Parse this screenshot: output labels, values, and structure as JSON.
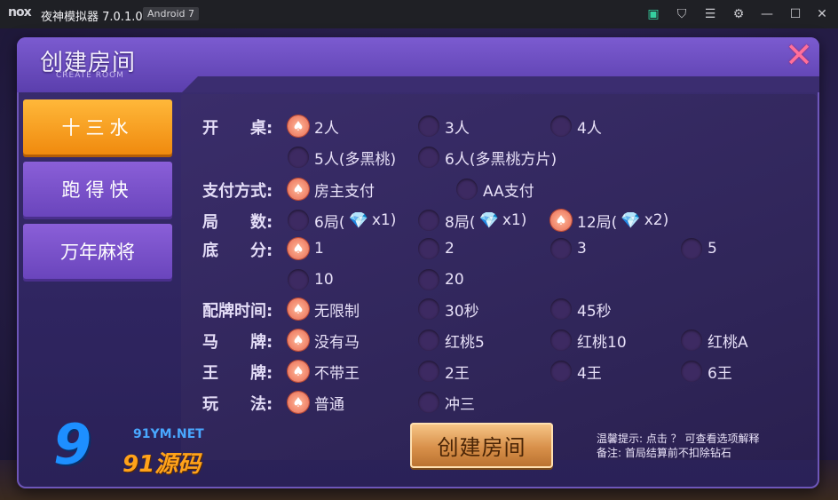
{
  "emulator": {
    "logo": "nox",
    "title": "夜神模拟器 7.0.1.0",
    "android": "Android 7",
    "icons": [
      "bag-icon",
      "shirt-icon",
      "menu-icon",
      "gear-icon",
      "minimize-icon",
      "maximize-icon",
      "close-icon"
    ]
  },
  "dialog": {
    "title": "创建房间",
    "subtitle": "CREATE ROOM",
    "close": "✕"
  },
  "tabs": [
    {
      "label": "十三水",
      "active": true
    },
    {
      "label": "跑得快",
      "active": false
    },
    {
      "label": "万年麻将",
      "active": false
    }
  ],
  "rows": {
    "tables": {
      "label": "开　　桌:",
      "options": [
        "2人",
        "3人",
        "4人",
        "5人(多黑桃)",
        "6人(多黑桃方片)"
      ],
      "selected": "2人"
    },
    "payment": {
      "label": "支付方式:",
      "options": [
        "房主支付",
        "AA支付"
      ],
      "selected": "房主支付"
    },
    "rounds": {
      "label": "局　　数:",
      "options": [
        {
          "text": "6局(",
          "mult": "x1)"
        },
        {
          "text": "8局(",
          "mult": "x1)"
        },
        {
          "text": "12局(",
          "mult": "x2)"
        }
      ],
      "selected": "12局"
    },
    "score": {
      "label": "底　　分:",
      "options": [
        "1",
        "2",
        "3",
        "5",
        "10",
        "20"
      ],
      "selected": "1"
    },
    "time": {
      "label": "配牌时间:",
      "options": [
        "无限制",
        "30秒",
        "45秒"
      ],
      "selected": "无限制"
    },
    "horse": {
      "label": "马　　牌:",
      "options": [
        "没有马",
        "红桃5",
        "红桃10",
        "红桃A"
      ],
      "selected": "没有马"
    },
    "king": {
      "label": "王　　牌:",
      "options": [
        "不带王",
        "2王",
        "4王",
        "6王"
      ],
      "selected": "不带王"
    },
    "play": {
      "label": "玩　　法:",
      "options": [
        "普通",
        "冲三"
      ],
      "selected": "普通"
    }
  },
  "create_button": "创建房间",
  "hints": {
    "line1": "温馨提示: 点击 ？ 可查看选项解释",
    "line2": "备注: 首局结算前不扣除钻石"
  },
  "watermark": {
    "logo": "9",
    "url": "91YM.NET",
    "text": "91源码"
  },
  "colors": {
    "accent": "#f08a0e",
    "tab": "#7a52cc",
    "selected_radio": "#e86a52",
    "close": "#ff6f9a"
  }
}
